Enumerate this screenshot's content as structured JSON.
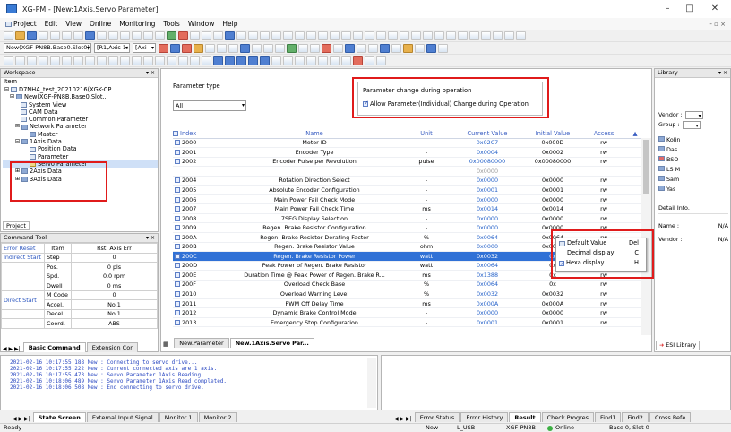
{
  "window": {
    "title": "XG-PM - [New:1Axis.Servo Parameter]",
    "minimize": "–",
    "maximize": "□",
    "close": "✕",
    "mdi_controls": "- ▫ ×"
  },
  "menu": [
    "Project",
    "Edit",
    "View",
    "Online",
    "Monitoring",
    "Tools",
    "Window",
    "Help"
  ],
  "toolbar": {
    "plc_type": "New(XGF-PN8B.Base0.Slot0)",
    "axis_select": "[R1,Axis 1:",
    "axis_combo": "[Axi"
  },
  "workspace": {
    "header": "Workspace",
    "item_label": "Item",
    "tree": [
      "D7NHA_test_20210216(XGK-CP...",
      "New(XGF-PN8B,Base0,Slot...",
      "System View",
      "CAM Data",
      "Common Parameter",
      "Network Parameter",
      "Master",
      "1Axis Data",
      "Position Data",
      "Parameter",
      "Servo Parameter",
      "2Axis Data",
      "3Axis Data"
    ],
    "tab": "Project"
  },
  "command_tool": {
    "header": "Command Tool",
    "tabs": [
      "Error Reset",
      "Item",
      "Rst. Axis Err"
    ],
    "indirect_start": "Indirect Start",
    "direct_start": "Direct Start",
    "rows": [
      {
        "item": "Step",
        "value": "0"
      },
      {
        "item": "Pos.",
        "value": "0 pls"
      },
      {
        "item": "Spd.",
        "value": "0.0 rpm"
      },
      {
        "item": "Dwell",
        "value": "0 ms"
      },
      {
        "item": "M Code",
        "value": "0"
      },
      {
        "item": "Accel.",
        "value": "No.1"
      },
      {
        "item": "Decel.",
        "value": "No.1"
      },
      {
        "item": "Coord.",
        "value": "ABS"
      }
    ],
    "bottom_tabs": [
      "Basic Command",
      "Extension Cor"
    ]
  },
  "param_panel": {
    "type_label": "Parameter type",
    "type_value": "All",
    "change_label": "Parameter change during operation",
    "allow_label": "Allow Parameter(Individual) Change during Operation",
    "columns": [
      "Index",
      "Name",
      "Unit",
      "Current Value",
      "Initial Value",
      "Access"
    ],
    "rows": [
      {
        "index": "2000",
        "name": "Motor ID",
        "unit": "-",
        "current": "0x02C7",
        "initial": "0x000D",
        "access": "rw"
      },
      {
        "index": "2001",
        "name": "Encoder Type",
        "unit": "-",
        "current": "0x0004",
        "initial": "0x0002",
        "access": "rw"
      },
      {
        "index": "2002",
        "name": "Encoder Pulse per Revolution",
        "unit": "pulse",
        "current": "0x00080000",
        "initial": "0x00080000",
        "access": "rw"
      },
      {
        "index": "",
        "name": "",
        "unit": "",
        "current": "0x0000",
        "initial": "",
        "access": ""
      },
      {
        "index": "2004",
        "name": "Rotation Direction Select",
        "unit": "-",
        "current": "0x0000",
        "initial": "0x0000",
        "access": "rw"
      },
      {
        "index": "2005",
        "name": "Absolute Encoder Configuration",
        "unit": "-",
        "current": "0x0001",
        "initial": "0x0001",
        "access": "rw"
      },
      {
        "index": "2006",
        "name": "Main Power Fail Check Mode",
        "unit": "-",
        "current": "0x0000",
        "initial": "0x0000",
        "access": "rw"
      },
      {
        "index": "2007",
        "name": "Main Power Fail Check Time",
        "unit": "ms",
        "current": "0x0014",
        "initial": "0x0014",
        "access": "rw"
      },
      {
        "index": "2008",
        "name": "7SEG Display Selection",
        "unit": "-",
        "current": "0x0000",
        "initial": "0x0000",
        "access": "rw"
      },
      {
        "index": "2009",
        "name": "Regen. Brake Resistor Configuration",
        "unit": "-",
        "current": "0x0000",
        "initial": "0x0000",
        "access": "rw"
      },
      {
        "index": "200A",
        "name": "Regen. Brake Resistor Derating Factor",
        "unit": "%",
        "current": "0x0064",
        "initial": "0x0064",
        "access": "rw"
      },
      {
        "index": "200B",
        "name": "Regen. Brake Resistor Value",
        "unit": "ohm",
        "current": "0x0000",
        "initial": "0x0000",
        "access": "rw"
      },
      {
        "index": "200C",
        "name": "Regen. Brake Resistor Power",
        "unit": "watt",
        "current": "0x0032",
        "initial": "0x",
        "access": "rw"
      },
      {
        "index": "200D",
        "name": "Peak Power of Regen. Brake Resistor",
        "unit": "watt",
        "current": "0x0064",
        "initial": "0x",
        "access": "rw"
      },
      {
        "index": "200E",
        "name": "Duration Time @ Peak Power of Regen. Brake R...",
        "unit": "ms",
        "current": "0x1388",
        "initial": "0x",
        "access": "rw"
      },
      {
        "index": "200F",
        "name": "Overload Check Base",
        "unit": "%",
        "current": "0x0064",
        "initial": "0x",
        "access": "rw"
      },
      {
        "index": "2010",
        "name": "Overload Warning Level",
        "unit": "%",
        "current": "0x0032",
        "initial": "0x0032",
        "access": "rw"
      },
      {
        "index": "2011",
        "name": "PWM Off Delay Time",
        "unit": "ms",
        "current": "0x000A",
        "initial": "0x000A",
        "access": "rw"
      },
      {
        "index": "2012",
        "name": "Dynamic Brake Control Mode",
        "unit": "-",
        "current": "0x0000",
        "initial": "0x0000",
        "access": "rw"
      },
      {
        "index": "2013",
        "name": "Emergency Stop Configuration",
        "unit": "-",
        "current": "0x0001",
        "initial": "0x0001",
        "access": "rw"
      }
    ],
    "tabs": [
      "New.Parameter",
      "New.1Axis.Servo Par..."
    ]
  },
  "context_menu": [
    {
      "label": "Default Value",
      "key": "Del"
    },
    {
      "label": "Decimal display",
      "key": "C"
    },
    {
      "label": "Hexa display",
      "key": "H"
    }
  ],
  "library": {
    "header": "Library",
    "vendor_label": "Vendor :",
    "group_label": "Group :",
    "items": [
      "Kolin",
      "Das",
      "BSO",
      "LS M",
      "Sam",
      "Yas"
    ],
    "detail_label": "Detail Info.",
    "name_label": "Name :",
    "name_value": "N/A",
    "vendor2_label": "Vendor :",
    "vendor2_value": "N/A",
    "tab": "ESI Library"
  },
  "log": {
    "lines": [
      "2021-02-16 10:17:55:188 New : Connecting to servo drive...",
      "2021-02-16 10:17:55:222 New : Current connected axis are 1 axis.",
      "2021-02-16 10:17:55:473 New : Servo Parameter 1Axis Reading...",
      "2021-02-16 10:18:06:489 New : Servo Parameter 1Axis Read completed.",
      "2021-02-16 10:18:06:508 New : End connecting to servo drive."
    ],
    "tabs": [
      "State Screen",
      "External Input Signal",
      "Monitor 1",
      "Monitor 2"
    ],
    "right_tabs": [
      "Error Status",
      "Error History",
      "Result",
      "Check Progres",
      "Find1",
      "Find2",
      "Cross Refe"
    ]
  },
  "status": {
    "ready": "Ready",
    "new": "New",
    "conn": "L_USB",
    "module": "XGF-PN8B",
    "online": "Online",
    "base": "Base 0, Slot 0"
  }
}
